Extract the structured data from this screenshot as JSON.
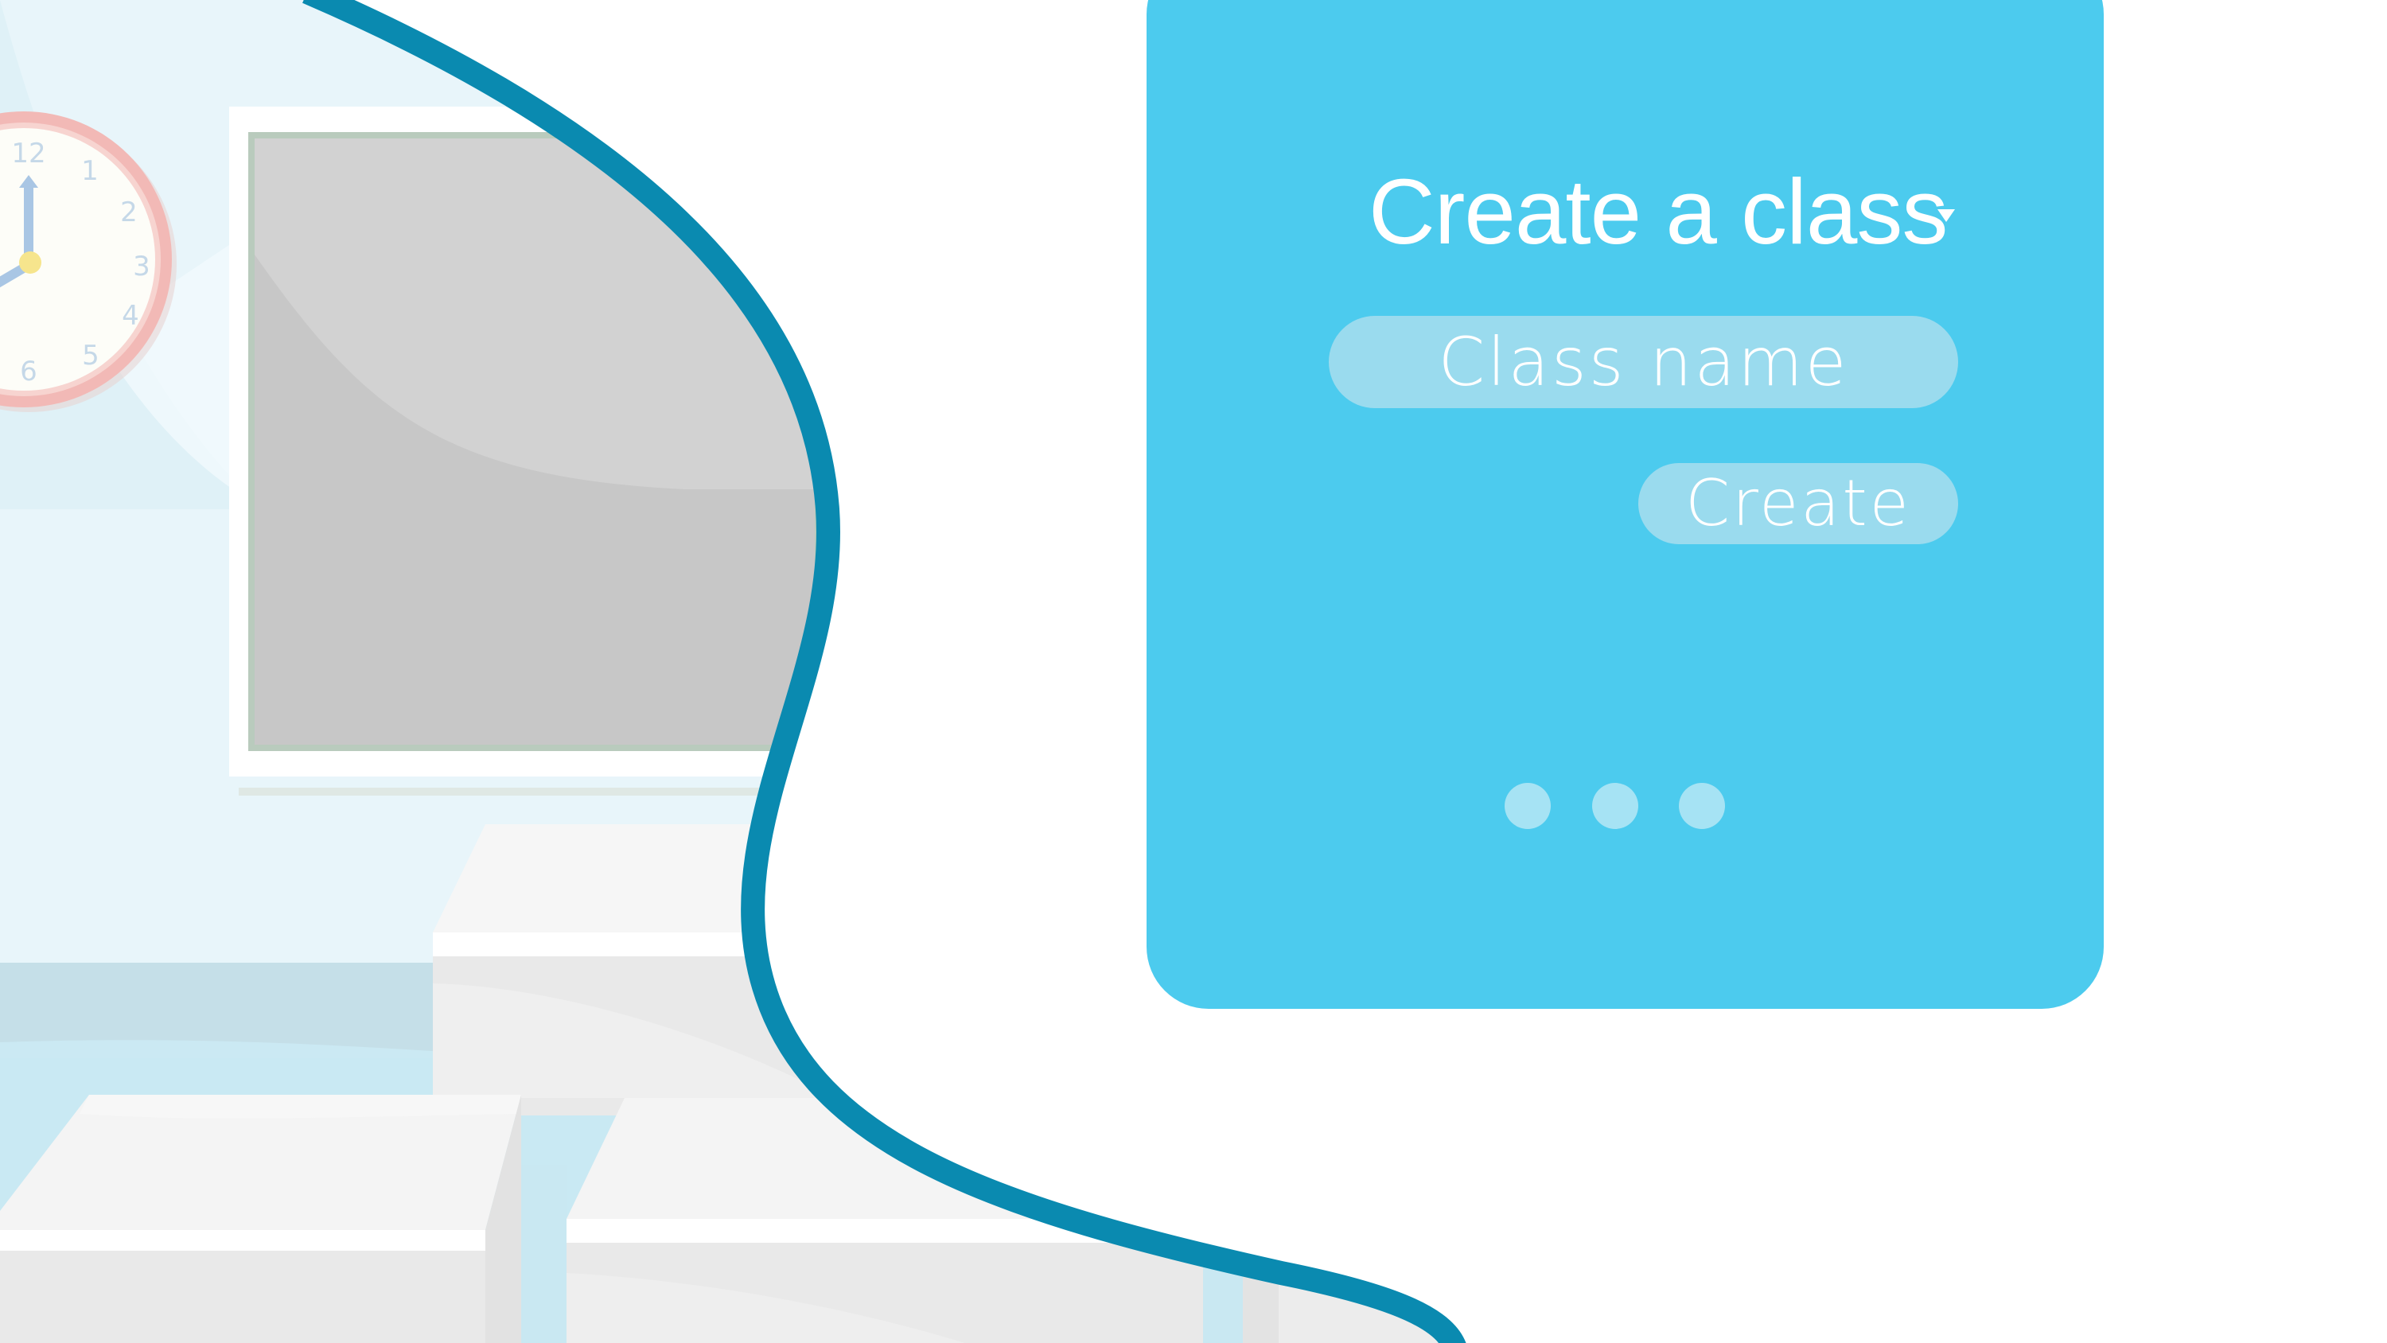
{
  "create_panel": {
    "title": "Create a class",
    "class_name_input": {
      "value": "",
      "placeholder": "Class name"
    },
    "create_button_label": "Create",
    "pagination_dots": 3
  },
  "colors": {
    "panel_background": "#4ccbee",
    "input_background": "#9adbee",
    "dot_color": "#a6e3f4",
    "divider_curve": "#0a8ab0",
    "classroom_wall": "#e5f4f9",
    "whiteboard": "#c8c8c8",
    "clock_rim": "#f3b3b3"
  },
  "icons": {
    "title_dropdown": "caret-down-icon",
    "clock": "wall-clock-icon"
  }
}
